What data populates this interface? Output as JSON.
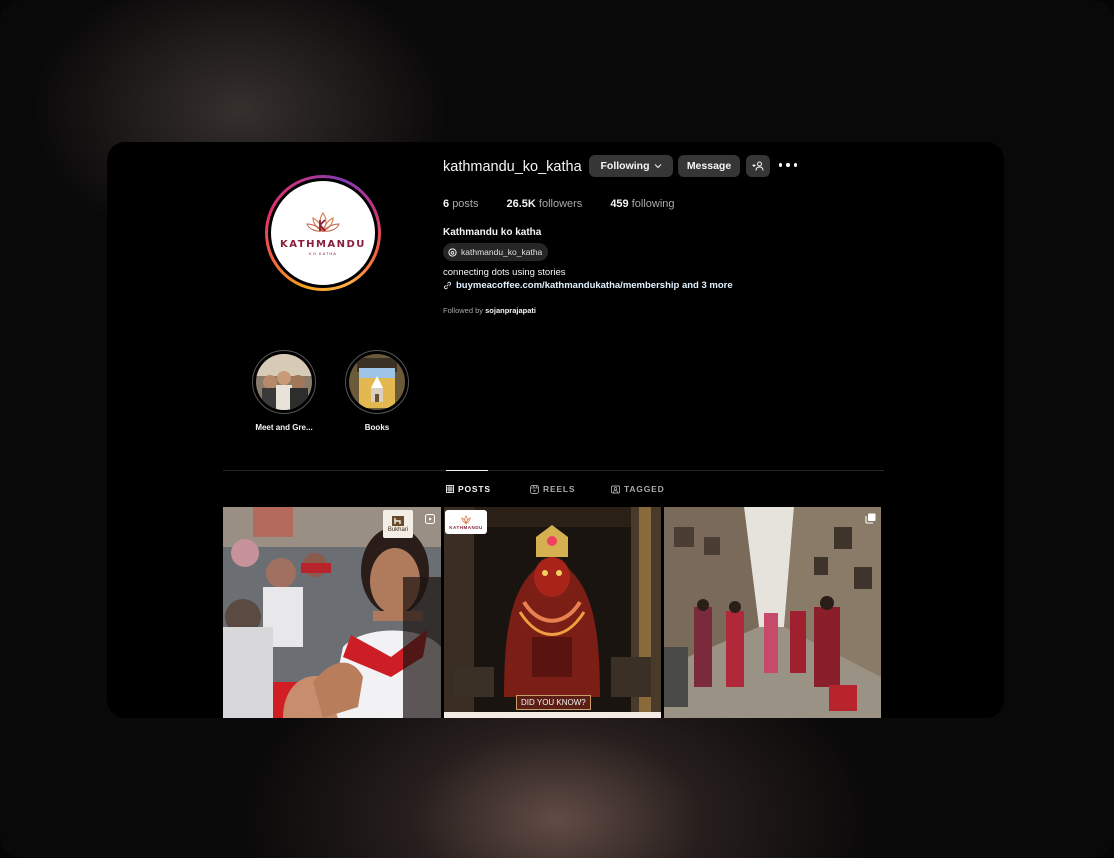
{
  "profile": {
    "username": "kathmandu_ko_katha",
    "following_button": "Following",
    "message_button": "Message",
    "stats": {
      "posts_count": "6",
      "posts_label": "posts",
      "followers_count": "26.5K",
      "followers_label": "followers",
      "following_count": "459",
      "following_label": "following"
    },
    "full_name": "Kathmandu ko katha",
    "threads_handle": "kathmandu_ko_katha",
    "bio": "connecting dots using stories",
    "link": "buymeacoffee.com/kathmandukatha/membership and 3 more",
    "followed_by_prefix": "Followed by",
    "followed_by_user": "sojanprajapati",
    "avatar_logo_text": "KATHMANDU",
    "avatar_logo_sub": "KO KATHA"
  },
  "highlights": [
    {
      "label": "Meet and Gre..."
    },
    {
      "label": "Books"
    }
  ],
  "tabs": [
    {
      "label": "POSTS",
      "active": true
    },
    {
      "label": "REELS",
      "active": false
    },
    {
      "label": "TAGGED",
      "active": false
    }
  ],
  "posts": [
    {
      "kind": "reel",
      "overlay_logo": "Bukhari"
    },
    {
      "kind": "image",
      "overlay_logo": "KATHMANDU",
      "overlay_text": "DID YOU KNOW?"
    },
    {
      "kind": "carousel"
    }
  ],
  "colors": {
    "background": "#000000",
    "button": "#363636",
    "text_primary": "#f5f5f5",
    "text_secondary": "#a8a8a8",
    "brand_maroon": "#8a1f3a"
  }
}
